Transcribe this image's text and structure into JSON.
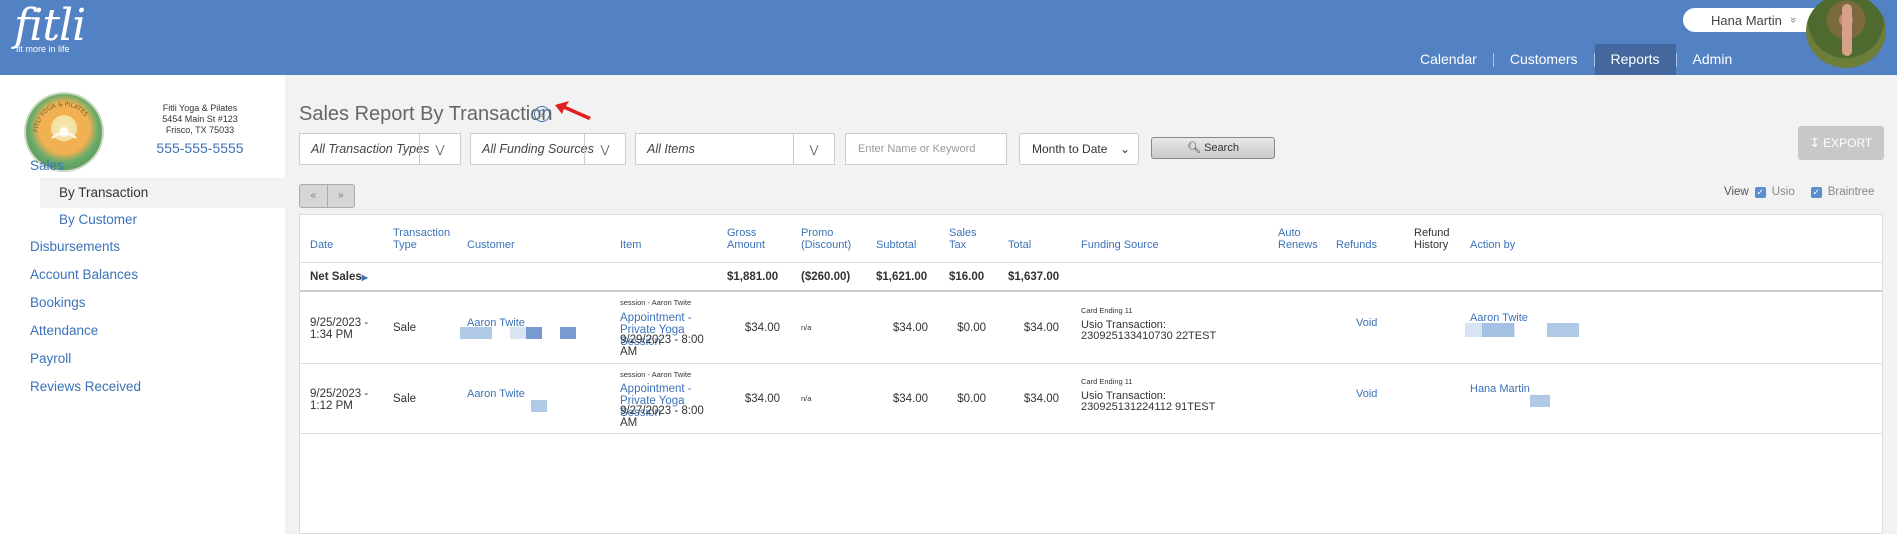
{
  "header": {
    "logo_text": "fitli",
    "logo_tagline": "fit more in life",
    "user_name": "Hana Martin",
    "user_caret": "»",
    "nav": [
      "Calendar",
      "Customers",
      "Reports",
      "Admin"
    ],
    "active_nav": "Reports"
  },
  "studio": {
    "logo_text": "FITLI YOGA & PILATES",
    "name": "Fitli Yoga & Pilates",
    "address1": "5454 Main St #123",
    "address2": "Frisco, TX 75033",
    "phone": "555-555-5555"
  },
  "sidebar": {
    "sales": "Sales",
    "sales_sub": [
      "By Transaction",
      "By Customer"
    ],
    "items": [
      "Disbursements",
      "Account Balances",
      "Bookings",
      "Attendance",
      "Payroll",
      "Reviews Received"
    ]
  },
  "page": {
    "title": "Sales Report By Transaction",
    "help_icon": "?",
    "filters": {
      "transaction_types": "All Transaction Types",
      "funding_sources": "All Funding Sources",
      "items": "All Items",
      "keyword_placeholder": "Enter Name or Keyword",
      "period": "Month to Date",
      "search_label": "Search",
      "export_label": "EXPORT"
    },
    "pager": {
      "prev": "«",
      "next": "»"
    },
    "view": {
      "label": "View",
      "options": [
        "Usio",
        "Braintree"
      ]
    }
  },
  "table": {
    "columns": [
      "Date",
      "Transaction Type",
      "Customer",
      "Item",
      "Gross Amount",
      "Promo (Discount)",
      "Subtotal",
      "Sales Tax",
      "Total",
      "Funding Source",
      "Auto Renews",
      "Refunds",
      "Refund History",
      "Action by"
    ],
    "net_sales": {
      "label": "Net Sales",
      "gross": "$1,881.00",
      "promo": "($260.00)",
      "subtotal": "$1,621.00",
      "tax": "$16.00",
      "total": "$1,637.00"
    },
    "rows": [
      {
        "date": "9/25/2023 - 1:34 PM",
        "type": "Sale",
        "customer": "Aaron Twite",
        "item_small": "session - Aaron Twite",
        "item_link": "Appointment - Private Yoga Session",
        "item_date": "9/29/2023 - 8:00 AM",
        "gross": "$34.00",
        "promo": "n/a",
        "subtotal": "$34.00",
        "tax": "$0.00",
        "total": "$34.00",
        "funding_small": "Card Ending 11",
        "funding_label": "Usio Transaction:",
        "funding_id": "230925133410730 22TEST",
        "refund": "Void",
        "action_by": "Aaron Twite"
      },
      {
        "date": "9/25/2023 - 1:12 PM",
        "type": "Sale",
        "customer": "Aaron Twite",
        "item_small": "session - Aaron Twite",
        "item_link": "Appointment - Private Yoga Session",
        "item_date": "9/27/2023 - 8:00 AM",
        "gross": "$34.00",
        "promo": "n/a",
        "subtotal": "$34.00",
        "tax": "$0.00",
        "total": "$34.00",
        "funding_small": "Card Ending 11",
        "funding_label": "Usio Transaction:",
        "funding_id": "230925131224112 91TEST",
        "refund": "Void",
        "action_by": "Hana Martin"
      }
    ]
  },
  "colors": {
    "topbar": "#5382c4",
    "nav_active": "#44689e",
    "link": "#3b72b8",
    "annotation_arrow": "#e02020"
  }
}
